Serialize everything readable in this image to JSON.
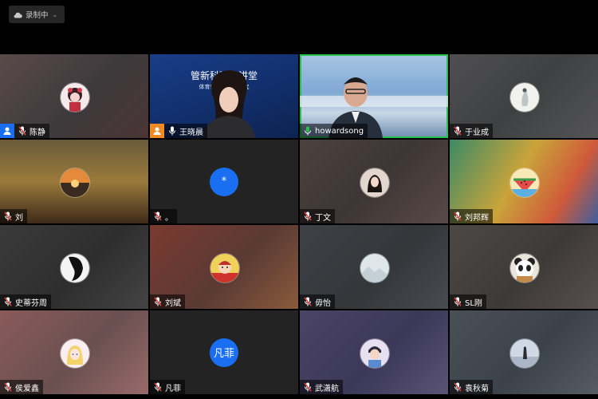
{
  "recording": {
    "label": "录制中",
    "icon": "cloud-icon",
    "expand_icon": "chevron-down-icon"
  },
  "participants": [
    {
      "name": "陈静",
      "host": true,
      "host_color": "#1a6ef2",
      "mic": "muted",
      "avatar": "illustrated-girl-avatar"
    },
    {
      "name": "王晓晨",
      "host": true,
      "host_color": "#f08a24",
      "mic": "on",
      "video": true,
      "slide_title": "管新科研大讲堂",
      "slide_subtitle": "体育领域的非…研究"
    },
    {
      "name": "howardsong",
      "host": false,
      "mic": "speaking",
      "video": true,
      "active_speaker": true
    },
    {
      "name": "于业成",
      "host": false,
      "mic": "muted",
      "avatar": "ink-figure-avatar"
    },
    {
      "name": "刘",
      "host": false,
      "mic": "muted",
      "avatar": "sunset-avatar"
    },
    {
      "name": "。",
      "host": false,
      "mic": "muted",
      "avatar_text": "*"
    },
    {
      "name": "丁文",
      "host": false,
      "mic": "muted",
      "avatar": "portrait-avatar"
    },
    {
      "name": "刘邦辉",
      "host": false,
      "mic": "muted",
      "avatar": "watermelon-avatar"
    },
    {
      "name": "史蒂芬周",
      "host": false,
      "mic": "muted",
      "avatar": "bw-portrait-avatar"
    },
    {
      "name": "刘斌",
      "host": false,
      "mic": "muted",
      "avatar": "cartoon-monk-avatar"
    },
    {
      "name": "毋怡",
      "host": false,
      "mic": "muted",
      "avatar": "landscape-avatar"
    },
    {
      "name": "SL刚",
      "host": false,
      "mic": "muted",
      "avatar": "panda-avatar"
    },
    {
      "name": "侯爱鑫",
      "host": false,
      "mic": "muted",
      "avatar": "anime-girl-avatar"
    },
    {
      "name": "凡菲",
      "host": false,
      "mic": "muted",
      "avatar_text": "凡菲"
    },
    {
      "name": "武潇航",
      "host": false,
      "mic": "muted",
      "avatar": "cartoon-boy-avatar"
    },
    {
      "name": "袁秋菊",
      "host": false,
      "mic": "muted",
      "avatar": "figure-on-beach-avatar"
    }
  ],
  "colors": {
    "active_border": "#27c24c",
    "host_blue": "#1a6ef2",
    "host_orange": "#f08a24",
    "mic_muted": "#e04646",
    "mic_on": "#27c24c"
  }
}
